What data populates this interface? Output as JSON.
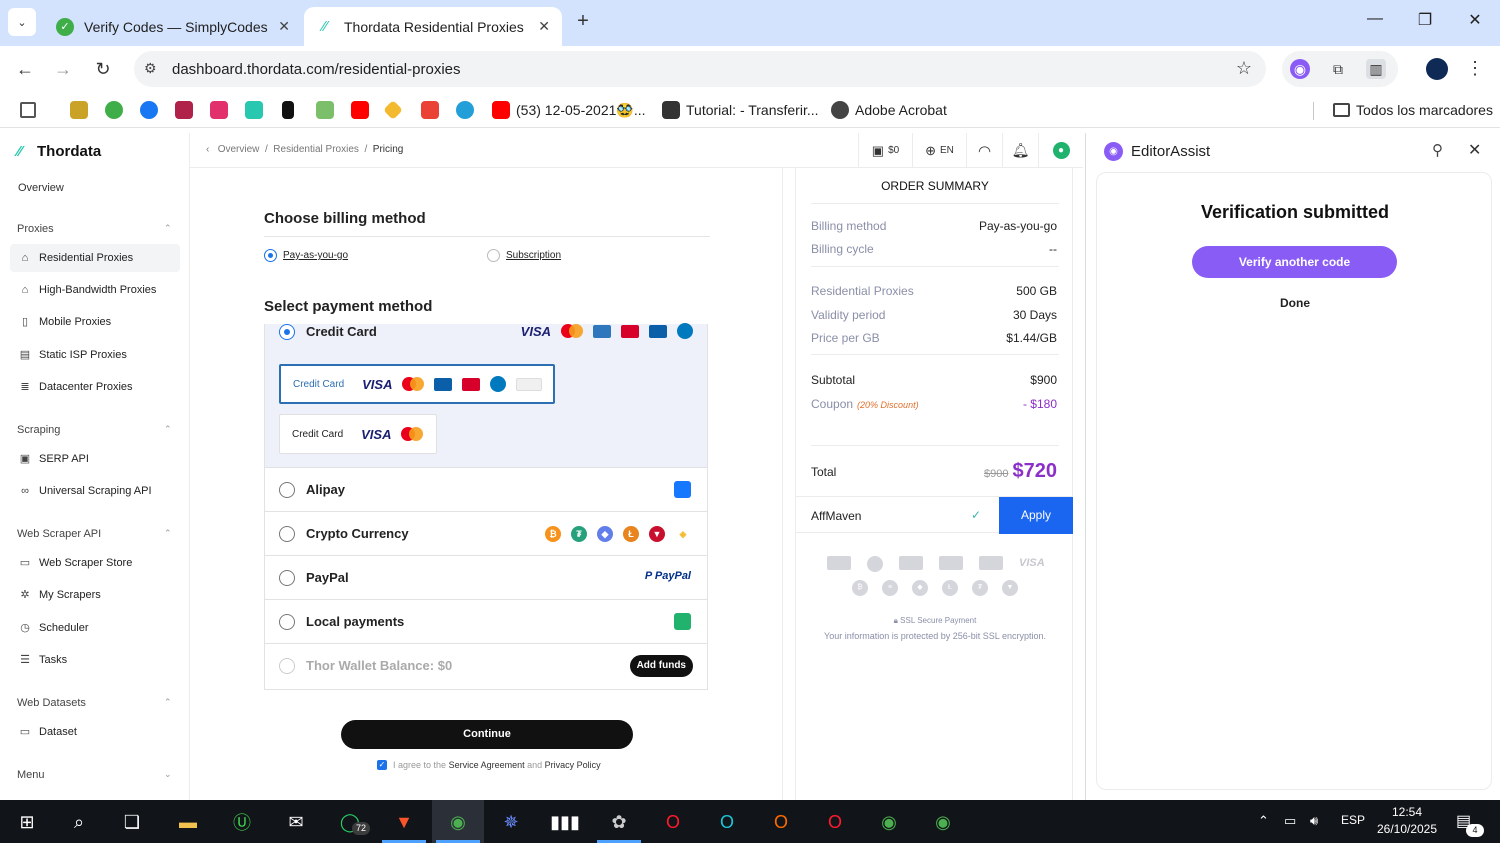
{
  "browser": {
    "tabs": [
      {
        "title": "Verify Codes — SimplyCodes",
        "active": false
      },
      {
        "title": "Thordata Residential Proxies",
        "active": true
      }
    ],
    "url": "dashboard.thordata.com/residential-proxies",
    "bookmarks": [
      {
        "label": "(53) 12-05-2021🥸..."
      },
      {
        "label": "Tutorial: - Transferir..."
      },
      {
        "label": "Adobe Acrobat"
      },
      {
        "label": "Todos los marcadores"
      }
    ]
  },
  "app": {
    "logo": "Thordata",
    "breadcrumb": {
      "items": [
        "Overview",
        "Residential Proxies"
      ],
      "current": "Pricing",
      "sep": "/"
    },
    "header": {
      "balance": "$0",
      "lang": "EN"
    },
    "sidebar": {
      "overview": "Overview",
      "sections": [
        {
          "title": "Proxies",
          "items": [
            "Residential Proxies",
            "High-Bandwidth Proxies",
            "Mobile Proxies",
            "Static ISP Proxies",
            "Datacenter Proxies"
          ]
        },
        {
          "title": "Scraping",
          "items": [
            "SERP API",
            "Universal Scraping API"
          ]
        },
        {
          "title": "Web Scraper API",
          "items": [
            "Web Scraper Store",
            "My Scrapers",
            "Scheduler",
            "Tasks"
          ]
        },
        {
          "title": "Web Datasets",
          "items": [
            "Dataset"
          ]
        },
        {
          "title": "Menu",
          "items": []
        }
      ]
    }
  },
  "checkout": {
    "billing_title": "Choose billing method",
    "billing_options": [
      {
        "label": "Pay-as-you-go",
        "selected": true
      },
      {
        "label": "Subscription",
        "selected": false
      }
    ],
    "payment_title": "Select payment method",
    "credit_card": {
      "label": "Credit Card",
      "cards": [
        {
          "label": "Credit Card",
          "selected": true
        },
        {
          "label": "Credit Card",
          "selected": false
        }
      ]
    },
    "methods": [
      {
        "label": "Alipay"
      },
      {
        "label": "Crypto Currency"
      },
      {
        "label": "PayPal"
      },
      {
        "label": "Local payments"
      },
      {
        "label": "Thor Wallet Balance: $0",
        "disabled": true
      }
    ],
    "add_funds": "Add funds",
    "continue": "Continue",
    "agree": {
      "prefix": "I agree to the",
      "link1": "Service Agreement",
      "and": "and",
      "link2": "Privacy Policy"
    }
  },
  "summary": {
    "title": "ORDER SUMMARY",
    "billing_method": {
      "label": "Billing method",
      "value": "Pay-as-you-go"
    },
    "billing_cycle": {
      "label": "Billing cycle",
      "value": "--"
    },
    "product": {
      "label": "Residential Proxies",
      "value": "500 GB"
    },
    "validity": {
      "label": "Validity period",
      "value": "30 Days"
    },
    "price_per_gb": {
      "label": "Price per GB",
      "value": "$1.44/GB"
    },
    "subtotal": {
      "label": "Subtotal",
      "value": "$900"
    },
    "coupon": {
      "label": "Coupon",
      "discount": "(20% Discount)",
      "value": "- $180"
    },
    "total": {
      "label": "Total",
      "old": "$900",
      "value": "$720"
    },
    "coupon_code": "AffMaven",
    "apply": "Apply",
    "ssl_title": "SSL Secure Payment",
    "ssl_text": "Your information is protected by 256-bit SSL encryption."
  },
  "panel": {
    "title": "EditorAssist",
    "heading": "Verification submitted",
    "verify_another": "Verify another code",
    "done": "Done"
  },
  "taskbar": {
    "whatsapp_badge": "72",
    "notif_badge": "4",
    "lang": "ESP",
    "time": "12:54",
    "date": "26/10/2025"
  },
  "colors": {
    "accent_purple": "#8a5cf6",
    "price_purple": "#8b2fc9",
    "apply_blue": "#1a66f0",
    "tab_strip": "#d3e3fd"
  }
}
